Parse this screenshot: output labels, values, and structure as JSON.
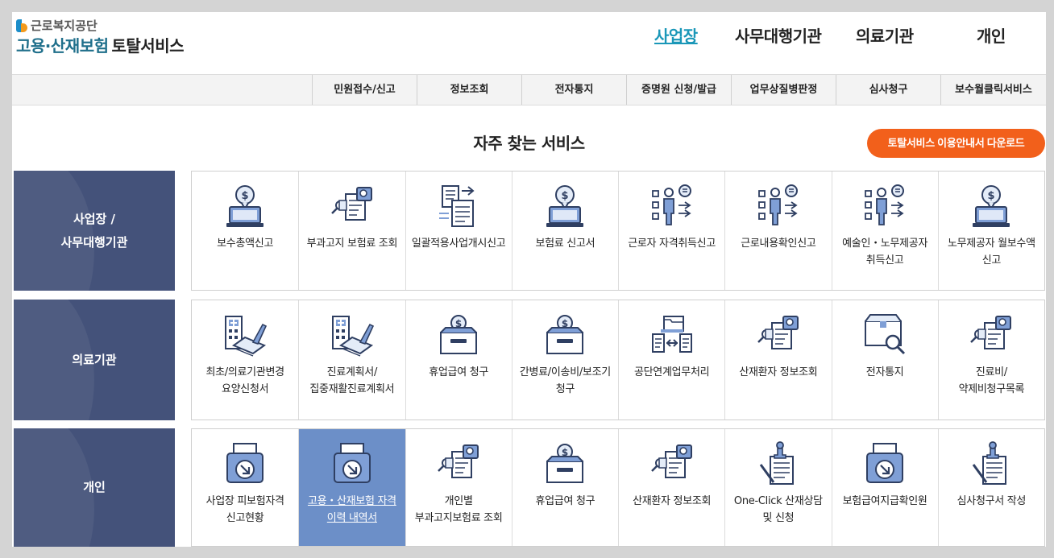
{
  "header": {
    "org_name": "근로복지공단",
    "service_title": "고용·산재보험",
    "service_sub": "토탈서비스",
    "nav": [
      {
        "label": "사업장",
        "active": true
      },
      {
        "label": "사무대행기관",
        "active": false
      },
      {
        "label": "의료기관",
        "active": false
      },
      {
        "label": "개인",
        "active": false
      }
    ]
  },
  "subnav": [
    "민원접수/신고",
    "정보조회",
    "전자통지",
    "증명원 신청/발급",
    "업무상질병판정",
    "심사청구",
    "보수월클릭서비스"
  ],
  "main": {
    "title": "자주 찾는 서비스",
    "guide_button": "토탈서비스 이용안내서 다운로드"
  },
  "rows": [
    {
      "label": "사업장 /\n사무대행기관",
      "items": [
        {
          "label": "보수총액신고",
          "icon": "money-laptop-icon"
        },
        {
          "label": "부과고지 보험료 조회",
          "icon": "document-search-icon"
        },
        {
          "label": "일괄적용사업개시신고",
          "icon": "documents-transfer-icon"
        },
        {
          "label": "보험료 신고서",
          "icon": "money-laptop-icon"
        },
        {
          "label": "근로자 자격취득신고",
          "icon": "person-checklist-icon"
        },
        {
          "label": "근로내용확인신고",
          "icon": "person-checklist-icon"
        },
        {
          "label": "예술인・노무제공자 취득신고",
          "icon": "person-checklist-icon"
        },
        {
          "label": "노무제공자 월보수액 신고",
          "icon": "money-laptop-icon"
        }
      ]
    },
    {
      "label": "의료기관",
      "items": [
        {
          "label": "최초/의료기관변경 요양신청서",
          "icon": "hospital-pen-icon"
        },
        {
          "label": "진료계획서/집중재활진료계획서",
          "icon": "hospital-pen-icon"
        },
        {
          "label": "휴업급여 청구",
          "icon": "money-box-icon"
        },
        {
          "label": "간병료/이송비/보조기 청구",
          "icon": "money-box-icon"
        },
        {
          "label": "공단연계업무처리",
          "icon": "folder-exchange-icon"
        },
        {
          "label": "산재환자 정보조회",
          "icon": "document-search-icon"
        },
        {
          "label": "전자통지",
          "icon": "box-search-icon"
        },
        {
          "label": "진료비/약제비청구목록",
          "icon": "document-search-icon"
        }
      ]
    },
    {
      "label": "개인",
      "items": [
        {
          "label": "사업장 피보험자격 신고현황",
          "icon": "printer-download-icon"
        },
        {
          "label": "고용・산재보험 자격 이력 내역서",
          "icon": "printer-download-icon",
          "selected": true
        },
        {
          "label": "개인별 부과고지보험료 조회",
          "icon": "document-search-icon"
        },
        {
          "label": "휴업급여 청구",
          "icon": "money-box-icon"
        },
        {
          "label": "산재환자 정보조회",
          "icon": "document-search-icon"
        },
        {
          "label": "One-Click 산재상담 및 신청",
          "icon": "stamp-document-icon"
        },
        {
          "label": "보험급여지급확인원",
          "icon": "printer-download-icon"
        },
        {
          "label": "심사청구서 작성",
          "icon": "stamp-document-icon"
        }
      ]
    }
  ],
  "colors": {
    "brand": "#1f6f8b",
    "active_nav": "#1a97b8",
    "row_label_bg": "#44527a",
    "selected_cell": "#6c8fc8",
    "guide_button": "#f2601b"
  }
}
